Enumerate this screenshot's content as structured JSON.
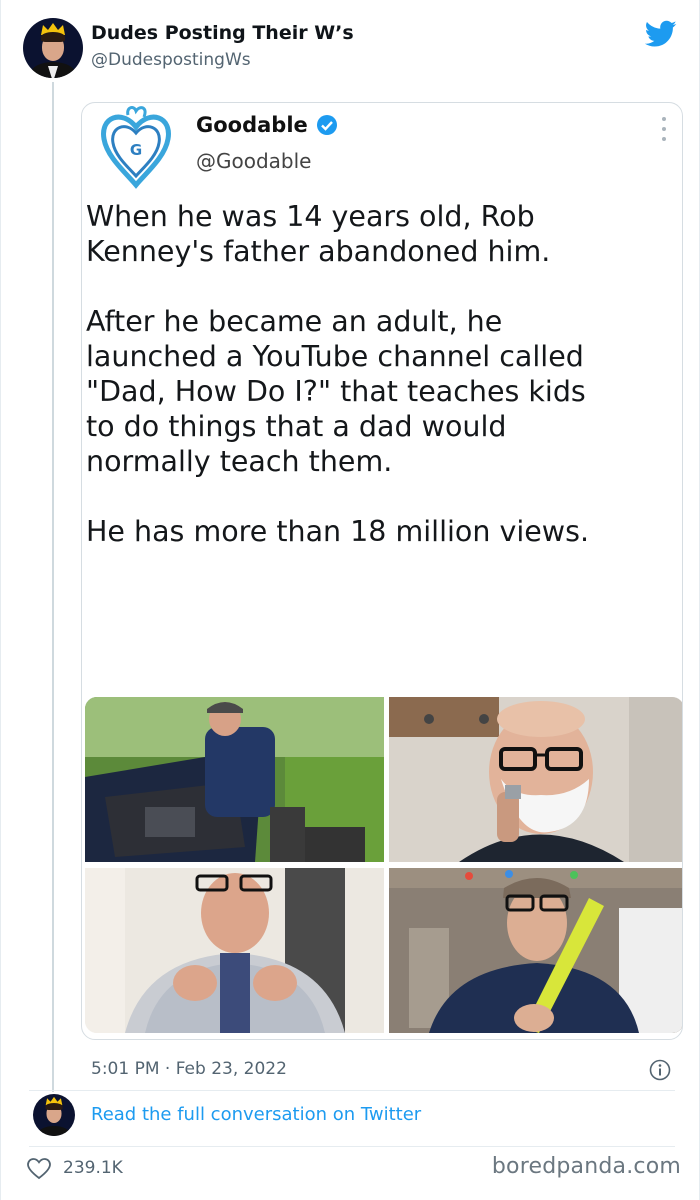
{
  "tweet": {
    "author_name": "Dudes Posting Their W’s",
    "author_handle": "@DudespostingWs",
    "timestamp": "5:01 PM · Feb 23, 2022",
    "read_more": "Read the full conversation on Twitter",
    "like_count": "239.1K",
    "icons": [
      "twitter-bird-icon",
      "info-icon",
      "heart-icon"
    ],
    "accent_color": "#1d9bf0"
  },
  "quoted": {
    "name": "Goodable",
    "handle": "@Goodable",
    "logo_letter": "G",
    "paragraphs": [
      "When he was 14 years old, Rob\nKenney's father abandoned him.",
      "After he became an adult, he\nlaunched a YouTube channel called\n\"Dad, How Do I?\" that teaches kids\nto do things that a dad would\nnormally teach them.",
      "He has more than 18 million views."
    ],
    "photos": [
      "man working on car engine",
      "man shaving with foam",
      "man tying a tie",
      "man holding a yellow tool"
    ]
  },
  "watermark": "boredpanda.com"
}
